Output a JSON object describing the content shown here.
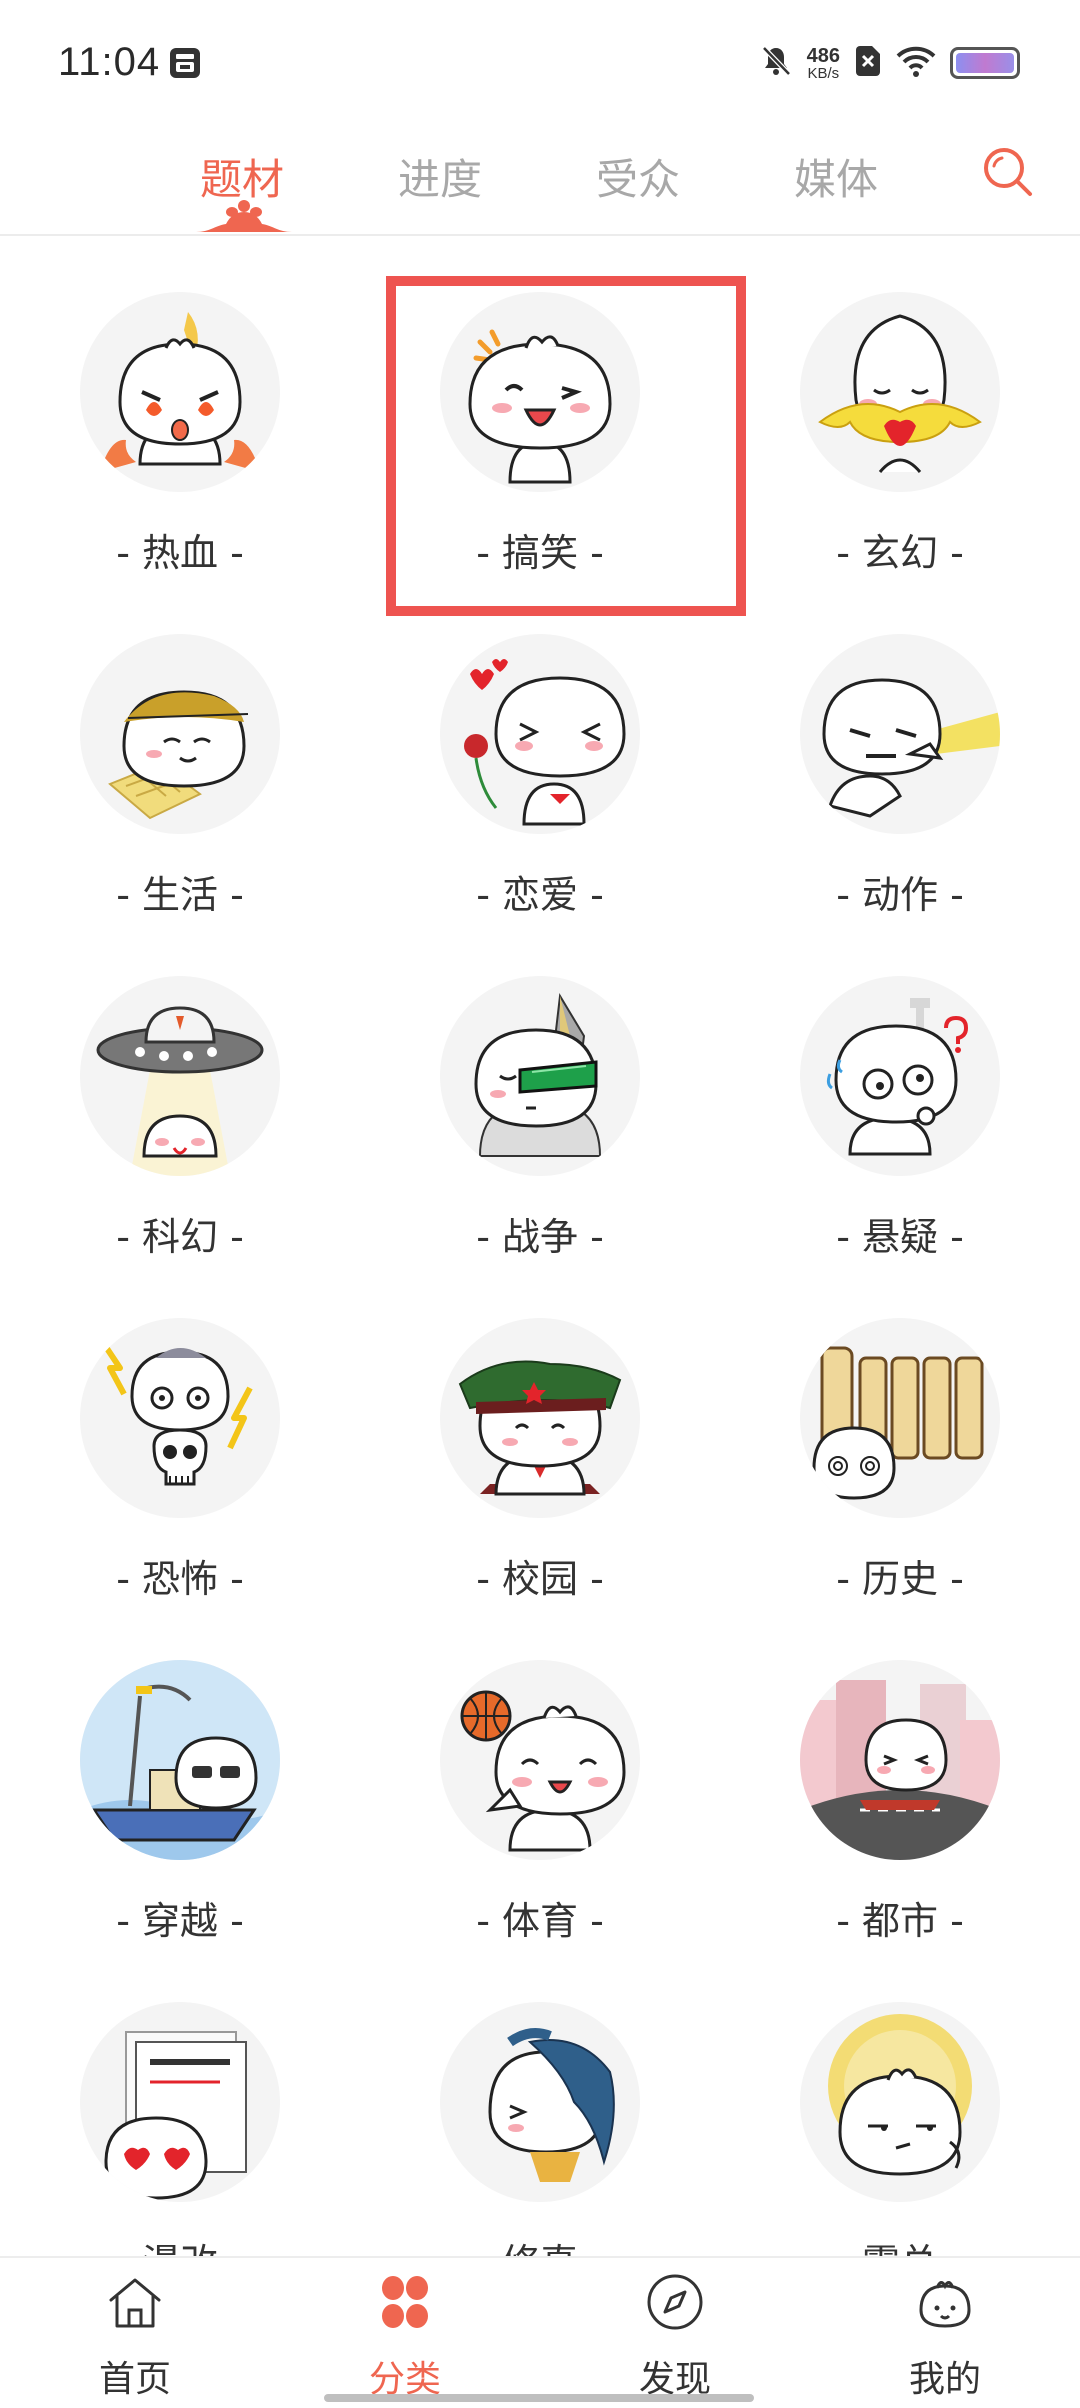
{
  "status_bar": {
    "time": "11:04",
    "net_speed_value": "486",
    "net_speed_unit": "KB/s",
    "icons": [
      "app-notification-icon",
      "mute-icon",
      "sim-off-icon",
      "wifi-icon",
      "battery-icon"
    ]
  },
  "tabs": [
    {
      "label": "题材",
      "active": true
    },
    {
      "label": "进度",
      "active": false
    },
    {
      "label": "受众",
      "active": false
    },
    {
      "label": "媒体",
      "active": false
    }
  ],
  "colors": {
    "accent": "#ef6650",
    "highlight": "#ee5450",
    "inactive": "#a8a8a8",
    "text": "#333333"
  },
  "categories": [
    {
      "label": "- 热血 -",
      "icon": "hot-blooded-bun-icon"
    },
    {
      "label": "- 搞笑 -",
      "icon": "funny-bun-icon"
    },
    {
      "label": "- 玄幻 -",
      "icon": "fantasy-bun-icon"
    },
    {
      "label": "- 生活 -",
      "icon": "life-bun-icon"
    },
    {
      "label": "- 恋爱 -",
      "icon": "romance-bun-icon"
    },
    {
      "label": "- 动作 -",
      "icon": "action-bun-icon"
    },
    {
      "label": "- 科幻 -",
      "icon": "scifi-bun-icon"
    },
    {
      "label": "- 战争 -",
      "icon": "war-bun-icon"
    },
    {
      "label": "- 悬疑 -",
      "icon": "mystery-bun-icon"
    },
    {
      "label": "- 恐怖 -",
      "icon": "horror-bun-icon"
    },
    {
      "label": "- 校园 -",
      "icon": "campus-bun-icon"
    },
    {
      "label": "- 历史 -",
      "icon": "history-bun-icon"
    },
    {
      "label": "- 穿越 -",
      "icon": "time-travel-bun-icon"
    },
    {
      "label": "- 体育 -",
      "icon": "sports-bun-icon"
    },
    {
      "label": "- 都市 -",
      "icon": "urban-bun-icon"
    },
    {
      "label": "- 漫改 -",
      "icon": "adaptation-bun-icon"
    },
    {
      "label": "- 修真 -",
      "icon": "cultivation-bun-icon"
    },
    {
      "label": "- 霸总 -",
      "icon": "ceo-bun-icon"
    }
  ],
  "bottom_nav": [
    {
      "label": "首页",
      "icon": "home-icon",
      "active": false
    },
    {
      "label": "分类",
      "icon": "category-icon",
      "active": true
    },
    {
      "label": "发现",
      "icon": "compass-icon",
      "active": false
    },
    {
      "label": "我的",
      "icon": "profile-bun-icon",
      "active": false
    }
  ]
}
